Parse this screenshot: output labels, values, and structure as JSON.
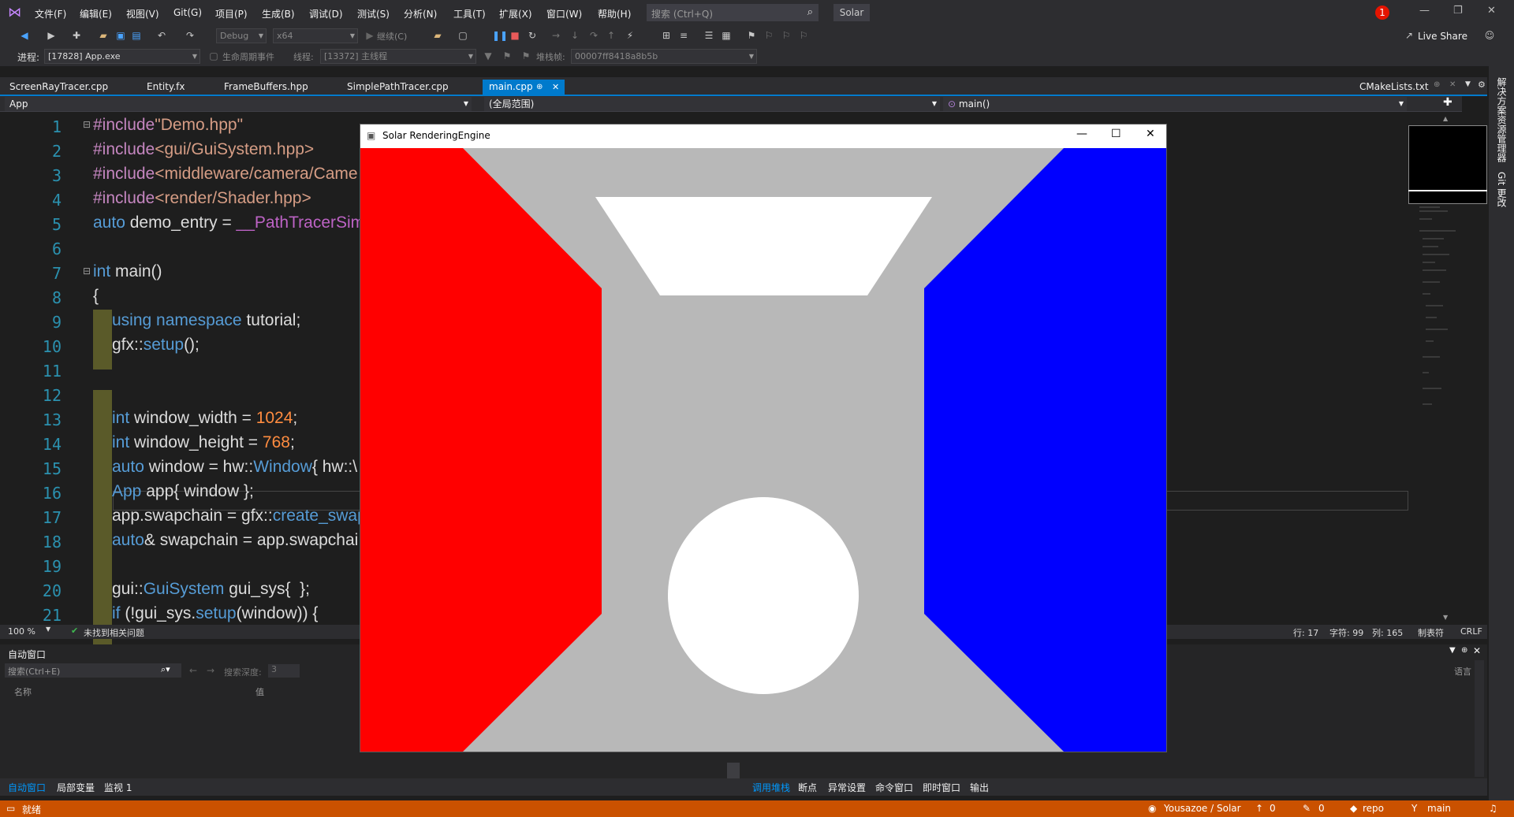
{
  "menubar": {
    "items": [
      "文件(F)",
      "编辑(E)",
      "视图(V)",
      "Git(G)",
      "项目(P)",
      "生成(B)",
      "调试(D)",
      "测试(S)",
      "分析(N)",
      "工具(T)",
      "扩展(X)",
      "窗口(W)",
      "帮助(H)"
    ],
    "search_placeholder": "搜索 (Ctrl+Q)",
    "solution_name": "Solar",
    "notification_count": "1"
  },
  "toolbar": {
    "config": "Debug",
    "platform": "x64",
    "continue_label": "继续(C)",
    "live_share": "Live Share",
    "process_label": "进程:",
    "process_value": "[17828] App.exe",
    "lifecycle_label": "生命周期事件",
    "thread_label": "线程:",
    "thread_value": "[13372] 主线程",
    "stackframe_label": "堆栈帧:",
    "stackframe_value": "00007ff8418a8b5b"
  },
  "tabs": {
    "open": [
      "ScreenRayTracer.cpp",
      "Entity.fx",
      "FrameBuffers.hpp",
      "SimplePathTracer.cpp",
      "main.cpp"
    ],
    "selected": "main.cpp",
    "right": "CMakeLists.txt"
  },
  "nav": {
    "project": "App",
    "scope": "(全局范围)",
    "member": "main()"
  },
  "editor": {
    "line_numbers": [
      "1",
      "2",
      "3",
      "4",
      "5",
      "6",
      "7",
      "8",
      "9",
      "10",
      "11",
      "12",
      "13",
      "14",
      "15",
      "16",
      "17",
      "18",
      "19",
      "20",
      "21"
    ],
    "lines": {
      "l1a": "#include",
      "l1b": "\"Demo.hpp\"",
      "l2a": "#include",
      "l2b": "<gui/GuiSystem.hpp>",
      "l3a": "#include",
      "l3b": "<middleware/camera/Came",
      "l4a": "#include",
      "l4b": "<render/Shader.hpp>",
      "l5a": "auto",
      "l5b": " demo_entry = ",
      "l5c": "__PathTracerSim",
      "l7a": "int",
      "l7b": " main()",
      "l8": "{",
      "l9a": "using namespace",
      "l9b": " tutorial;",
      "l10a": "gfx::",
      "l10b": "setup",
      "l10c": "();",
      "l13a": "int",
      "l13b": " window_width = ",
      "l13c": "1024",
      "l13d": ";",
      "l14a": "int",
      "l14b": " window_height = ",
      "l14c": "768",
      "l14d": ";",
      "l15a": "auto",
      "l15b": " window = hw::",
      "l15c": "Window",
      "l15d": "{ hw::\\",
      "l16a": "App",
      "l16b": " app{ window };",
      "l17a": "app.swapchain = gfx::",
      "l17b": "create_swap",
      "l18a": "auto",
      "l18b": "& swapchain = app.swapchai",
      "l20a": "gui::",
      "l20b": "GuiSystem",
      "l20c": " gui_sys{  };",
      "l21a": "if",
      "l21b": " (!gui_sys.",
      "l21c": "setup",
      "l21d": "(window)) {"
    },
    "zoom": "100 %",
    "issues": "未找到相关问题",
    "line": "行: 17",
    "char": "字符: 99",
    "col": "列: 165",
    "tabs_mode": "制表符",
    "eol": "CRLF"
  },
  "autos": {
    "title": "自动窗口",
    "search_placeholder": "搜索(Ctrl+E)",
    "depth_label": "搜索深度:",
    "depth_value": "3",
    "col_name": "名称",
    "col_value": "值",
    "col_lang": "语言"
  },
  "bottom_tabs_left": [
    "自动窗口",
    "局部变量",
    "监视 1"
  ],
  "bottom_tabs_right": [
    "调用堆栈",
    "断点",
    "异常设置",
    "命令窗口",
    "即时窗口",
    "输出"
  ],
  "right_vertical_tabs": [
    "解决方案资源管理器",
    "Git 更改"
  ],
  "statusbar": {
    "ready": "就绪",
    "repo_path": "Yousazoe / Solar",
    "push_count": "0",
    "edit_count": "0",
    "repo": "repo",
    "branch": "main"
  },
  "app_window": {
    "title": "Solar RenderingEngine",
    "colors": {
      "left_wall": "#ff0000",
      "right_wall": "#0000ff",
      "background": "#b8b8b8",
      "light": "#ffffff",
      "sphere": "#ffffff"
    }
  }
}
